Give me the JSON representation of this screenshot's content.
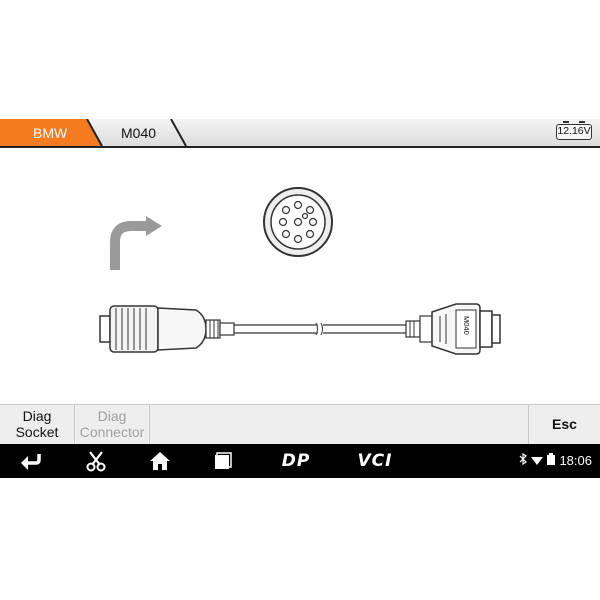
{
  "breadcrumb": {
    "items": [
      "BMW",
      "M040"
    ]
  },
  "battery": {
    "voltage": "12.16V"
  },
  "connector": {
    "label": "M040"
  },
  "function_bar": {
    "diag_socket": [
      "Diag",
      "Socket"
    ],
    "diag_connector": [
      "Diag",
      "Connector"
    ],
    "esc": "Esc"
  },
  "nav": {
    "dp_label": "DP",
    "vci_label": "VCI"
  },
  "status_bar": {
    "time": "18:06"
  },
  "colors": {
    "accent": "#f47b20",
    "nav_background": "#000000",
    "disabled_text": "#a0a0a0"
  }
}
